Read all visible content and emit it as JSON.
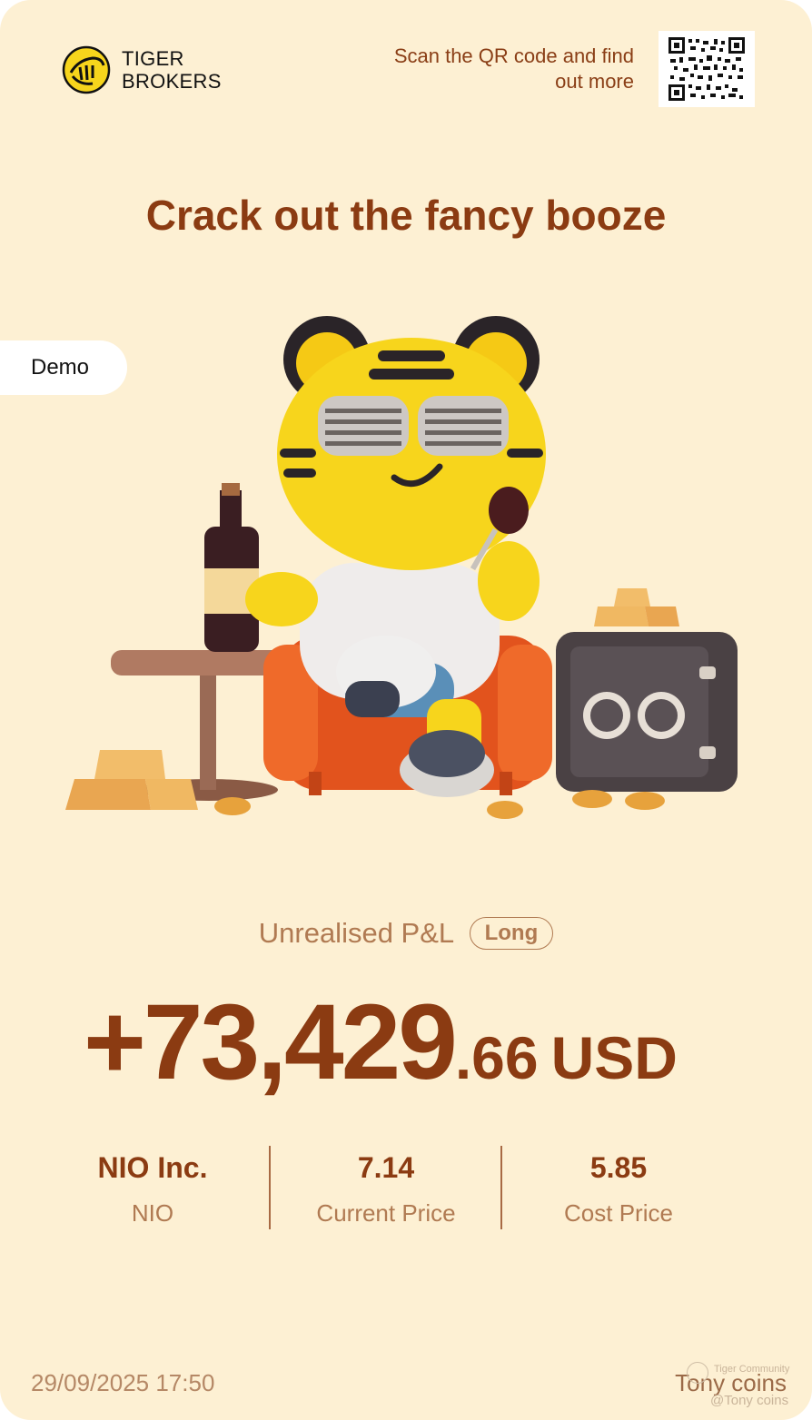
{
  "header": {
    "brand_line1": "TIGER",
    "brand_line2": "BROKERS",
    "scan_text": "Scan the QR code and find out more"
  },
  "headline": "Crack out the fancy booze",
  "demo_label": "Demo",
  "pnl": {
    "label": "Unrealised P&L",
    "position": "Long",
    "amount_integer": "+73,429",
    "amount_decimal": ".66",
    "currency": "USD"
  },
  "stats": [
    {
      "value": "NIO Inc.",
      "label": "NIO"
    },
    {
      "value": "7.14",
      "label": "Current Price"
    },
    {
      "value": "5.85",
      "label": "Cost Price"
    }
  ],
  "footer": {
    "datetime": "29/09/2025 17:50",
    "user": "Tony coins",
    "watermark_community": "Tiger Community",
    "watermark_user": "@Tony coins"
  },
  "colors": {
    "background": "#fdf0d3",
    "accent_brown": "#8b3b12",
    "muted_brown": "#b07a52",
    "tiger_yellow": "#f7d51c"
  }
}
